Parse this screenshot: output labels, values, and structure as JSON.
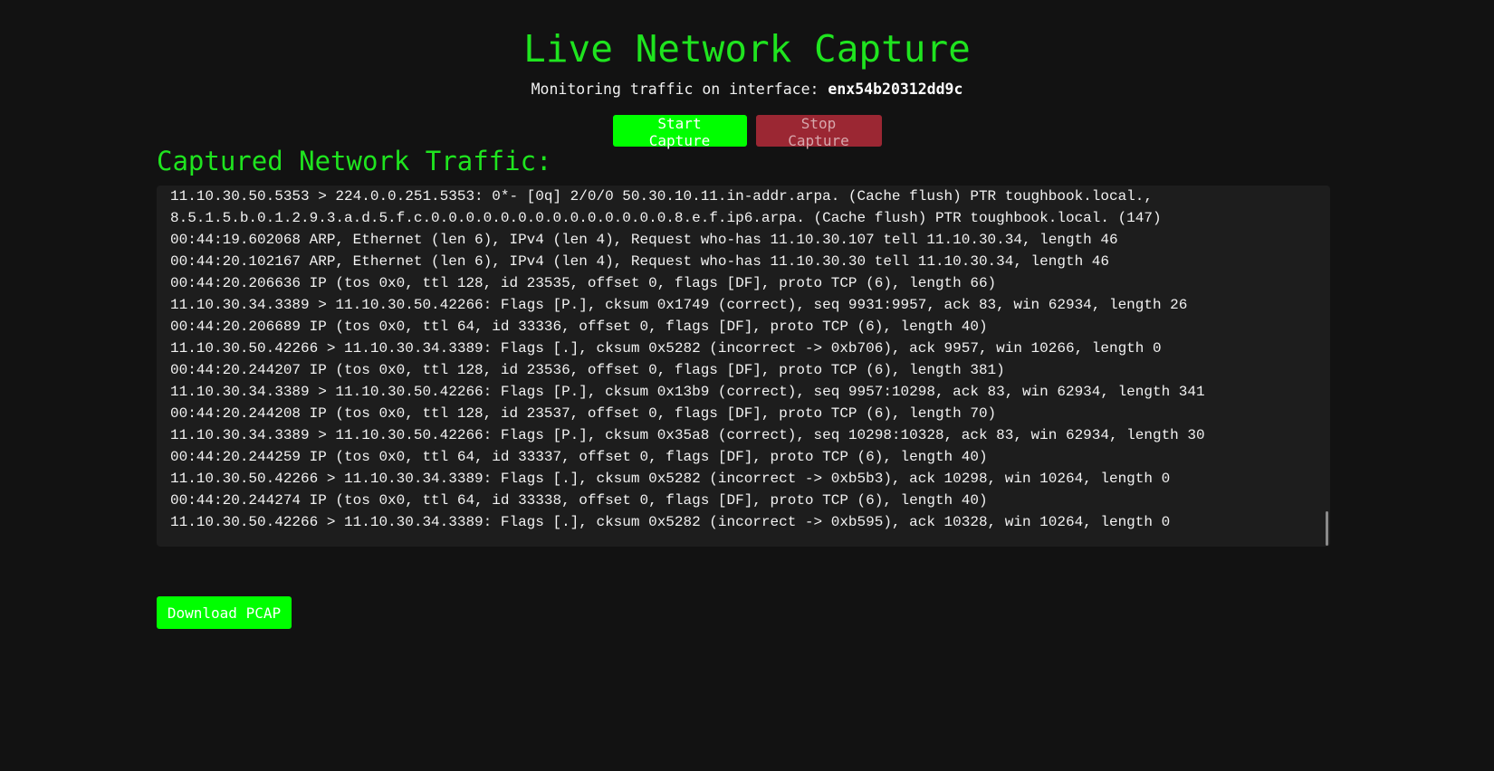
{
  "header": {
    "title": "Live Network Capture",
    "subtitle_prefix": "Monitoring traffic on interface:",
    "interface": "enx54b20312dd9c"
  },
  "controls": {
    "start_label": "Start Capture",
    "stop_label": "Stop Capture"
  },
  "traffic": {
    "heading": "Captured Network Traffic:",
    "lines": [
      "11.10.30.50.5353 > 224.0.0.251.5353: 0*- [0q] 2/0/0 50.30.10.11.in-addr.arpa. (Cache flush) PTR toughbook.local.,",
      "8.5.1.5.b.0.1.2.9.3.a.d.5.f.c.0.0.0.0.0.0.0.0.0.0.0.0.0.0.8.e.f.ip6.arpa. (Cache flush) PTR toughbook.local. (147)",
      "00:44:19.602068 ARP, Ethernet (len 6), IPv4 (len 4), Request who-has 11.10.30.107 tell 11.10.30.34, length 46",
      "00:44:20.102167 ARP, Ethernet (len 6), IPv4 (len 4), Request who-has 11.10.30.30 tell 11.10.30.34, length 46",
      "00:44:20.206636 IP (tos 0x0, ttl 128, id 23535, offset 0, flags [DF], proto TCP (6), length 66)",
      "11.10.30.34.3389 > 11.10.30.50.42266: Flags [P.], cksum 0x1749 (correct), seq 9931:9957, ack 83, win 62934, length 26",
      "00:44:20.206689 IP (tos 0x0, ttl 64, id 33336, offset 0, flags [DF], proto TCP (6), length 40)",
      "11.10.30.50.42266 > 11.10.30.34.3389: Flags [.], cksum 0x5282 (incorrect -> 0xb706), ack 9957, win 10266, length 0",
      "00:44:20.244207 IP (tos 0x0, ttl 128, id 23536, offset 0, flags [DF], proto TCP (6), length 381)",
      "11.10.30.34.3389 > 11.10.30.50.42266: Flags [P.], cksum 0x13b9 (correct), seq 9957:10298, ack 83, win 62934, length 341",
      "00:44:20.244208 IP (tos 0x0, ttl 128, id 23537, offset 0, flags [DF], proto TCP (6), length 70)",
      "11.10.30.34.3389 > 11.10.30.50.42266: Flags [P.], cksum 0x35a8 (correct), seq 10298:10328, ack 83, win 62934, length 30",
      "00:44:20.244259 IP (tos 0x0, ttl 64, id 33337, offset 0, flags [DF], proto TCP (6), length 40)",
      "11.10.30.50.42266 > 11.10.30.34.3389: Flags [.], cksum 0x5282 (incorrect -> 0xb5b3), ack 10298, win 10264, length 0",
      "00:44:20.244274 IP (tos 0x0, ttl 64, id 33338, offset 0, flags [DF], proto TCP (6), length 40)",
      "11.10.30.50.42266 > 11.10.30.34.3389: Flags [.], cksum 0x5282 (incorrect -> 0xb595), ack 10328, win 10264, length 0"
    ]
  },
  "download": {
    "label": "Download PCAP"
  },
  "colors": {
    "background": "#121212",
    "accent_green": "#00ff00",
    "title_green": "#1fe41f",
    "stop_red": "#9b2733",
    "panel": "#1d1d1d"
  }
}
